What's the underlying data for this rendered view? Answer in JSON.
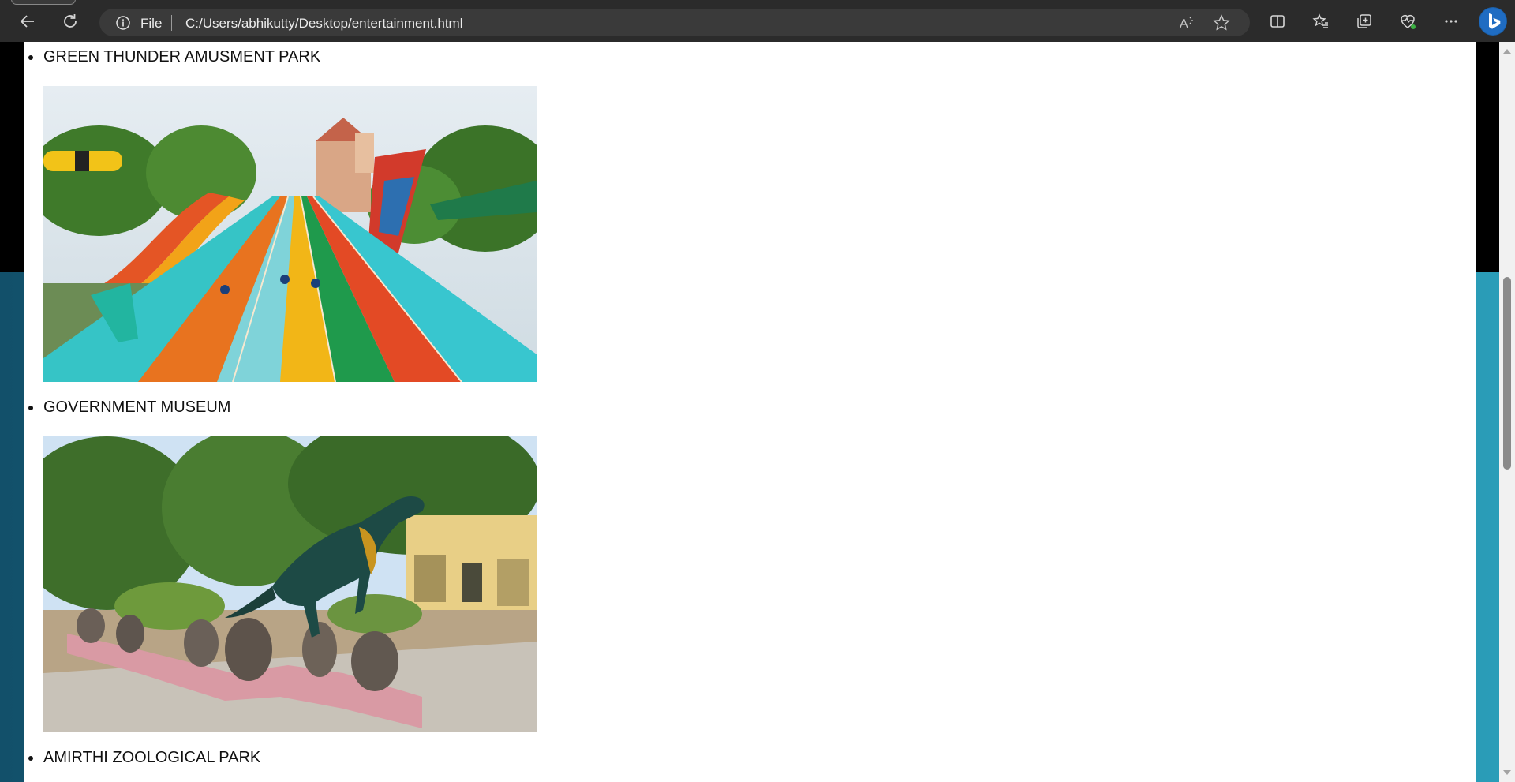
{
  "browser": {
    "address_scheme": "File",
    "address_url": "C:/Users/abhikutty/Desktop/entertainment.html"
  },
  "icons": {
    "back": "back-arrow-icon",
    "reload": "reload-icon",
    "info": "info-icon",
    "read_aloud": "read-aloud-icon",
    "favorite": "star-icon",
    "split_screen": "split-screen-icon",
    "favorites": "favorites-icon",
    "collections": "collections-icon",
    "health": "browser-essentials-icon",
    "more": "more-icon",
    "copilot": "bing-copilot-icon"
  },
  "page": {
    "places": [
      {
        "name": "GREEN THUNDER AMUSMENT PARK",
        "image": "water slides amusement park photo"
      },
      {
        "name": "GOVERNMENT MUSEUM",
        "image": "dinosaur statue museum photo"
      },
      {
        "name": "AMIRTHI ZOOLOGICAL PARK"
      }
    ]
  },
  "colors": {
    "chrome": "#2b2b2b",
    "address_bar": "#3a3a3a",
    "page_bg_top": "#000000",
    "page_bg_teal": "#1a7690"
  }
}
